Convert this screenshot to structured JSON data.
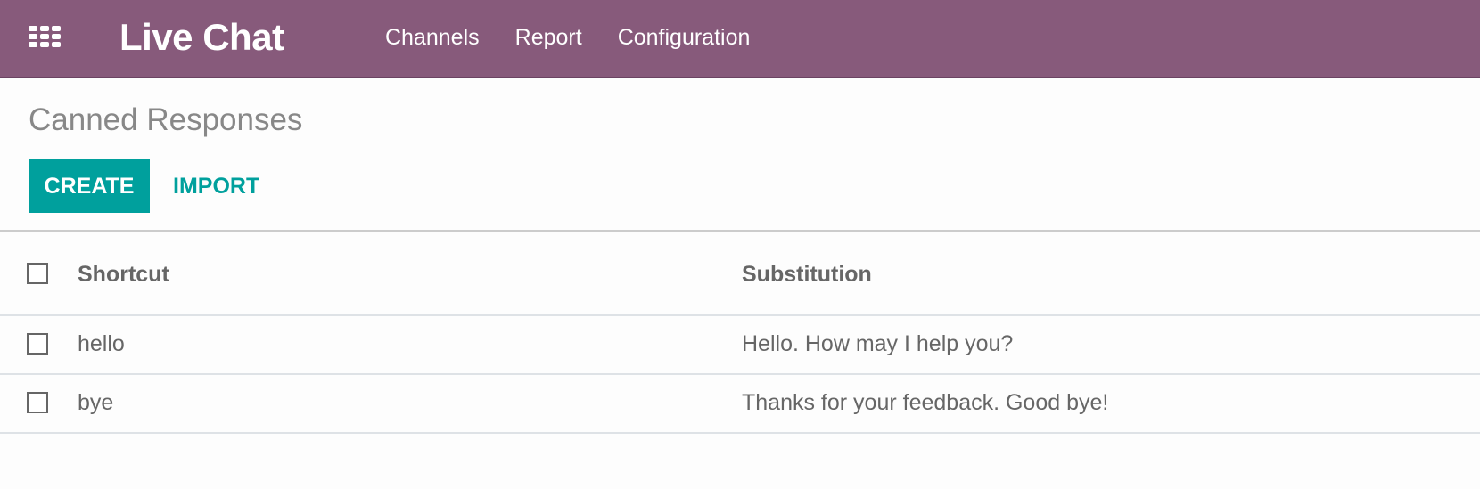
{
  "navbar": {
    "apps_icon": "grid-icon",
    "brand": "Live Chat",
    "menu": [
      "Channels",
      "Report",
      "Configuration"
    ]
  },
  "control_panel": {
    "title": "Canned Responses",
    "create_label": "CREATE",
    "import_label": "IMPORT"
  },
  "table": {
    "columns": [
      "Shortcut",
      "Substitution"
    ],
    "rows": [
      {
        "shortcut": "hello",
        "substitution": "Hello. How may I help you?"
      },
      {
        "shortcut": "bye",
        "substitution": "Thanks for your feedback. Good bye!"
      }
    ]
  },
  "colors": {
    "navbar": "#875a7b",
    "primary": "#00a09d"
  }
}
